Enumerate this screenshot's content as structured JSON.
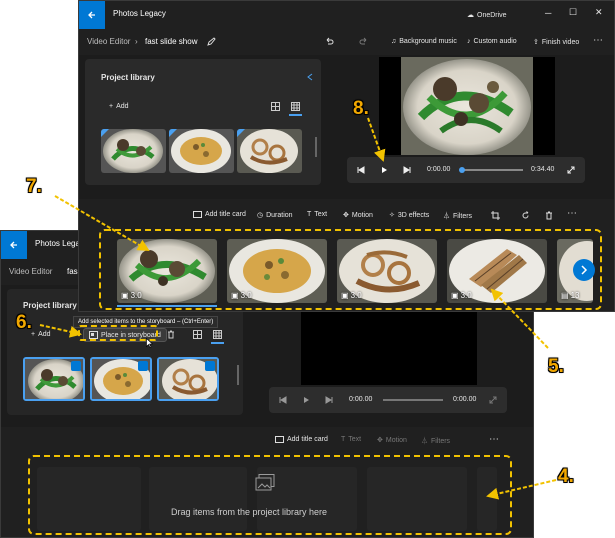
{
  "back_window": {
    "app_title": "Photos Legacy",
    "breadcrumb": {
      "root": "Video Editor",
      "current_partial": "fas"
    },
    "project_library": {
      "title": "Project library",
      "add_label": "Add",
      "place_in_storyboard_label": "Place in storyboard",
      "tooltip": "Add selected items to the storyboard – (Ctrl+Enter)"
    },
    "player": {
      "current_time": "0:00.00",
      "total_time": "0:00.00"
    },
    "storyboard_toolbar": {
      "add_title_card": "Add title card",
      "text": "Text",
      "motion": "Motion",
      "filters": "Filters"
    },
    "storyboard_empty_text": "Drag items from the project library here"
  },
  "front_window": {
    "app_title": "Photos Legacy",
    "onedrive_label": "OneDrive",
    "breadcrumb": {
      "root": "Video Editor",
      "current": "fast slide show"
    },
    "actions": {
      "background_music": "Background music",
      "custom_audio": "Custom audio",
      "finish_video": "Finish video"
    },
    "project_library": {
      "title": "Project library",
      "add_label": "Add"
    },
    "player": {
      "current_time": "0:00.00",
      "total_time": "0:34.40",
      "progress": 0
    },
    "storyboard_toolbar": {
      "add_title_card": "Add title card",
      "duration": "Duration",
      "text": "Text",
      "motion": "Motion",
      "3d_effects": "3D effects",
      "filters": "Filters"
    },
    "storyboard_clips": [
      {
        "duration": "3.0"
      },
      {
        "duration": "3.0"
      },
      {
        "duration": "3.0"
      },
      {
        "duration": "3.0"
      },
      {
        "duration": "13"
      }
    ]
  },
  "callouts": {
    "c4": "4.",
    "c5": "5.",
    "c6": "6.",
    "c7": "7.",
    "c8": "8."
  },
  "colors": {
    "accent": "#0078d4",
    "callout": "#f2a800",
    "dash": "#f2c200"
  },
  "icons": [
    "back-arrow-icon",
    "pencil-icon",
    "undo-icon",
    "redo-icon",
    "music-note-icon",
    "audio-icon",
    "export-icon",
    "more-icon",
    "play-icon",
    "next-frame-icon",
    "prev-frame-icon",
    "fullscreen-icon",
    "grid-icon",
    "trash-icon",
    "rotate-icon",
    "crop-icon",
    "filter-icon",
    "photo-icon",
    "chevron-right-icon"
  ]
}
